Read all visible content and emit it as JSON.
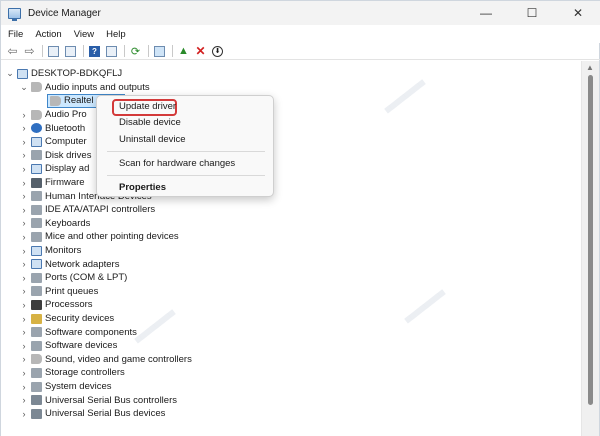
{
  "window": {
    "title": "Device Manager",
    "controls": {
      "minimize": "—",
      "maximize": "☐",
      "close": "✕"
    }
  },
  "menubar": [
    "File",
    "Action",
    "View",
    "Help"
  ],
  "toolbar": {
    "buttons": [
      "back-arrow",
      "forward-arrow",
      "properties-sheet",
      "show-hide-console",
      "help",
      "show-pane",
      "scan-hardware",
      "computer-monitor",
      "update-driver",
      "uninstall",
      "disable"
    ]
  },
  "tree": {
    "root": "DESKTOP-BDKQFLJ",
    "expanded_category": "Audio inputs and outputs",
    "selected_child": "Realtel",
    "categories": [
      "Audio Pro",
      "Bluetooth",
      "Computer",
      "Disk drives",
      "Display ad",
      "Firmware",
      "Human Interface Devices",
      "IDE ATA/ATAPI controllers",
      "Keyboards",
      "Mice and other pointing devices",
      "Monitors",
      "Network adapters",
      "Ports (COM & LPT)",
      "Print queues",
      "Processors",
      "Security devices",
      "Software components",
      "Software devices",
      "Sound, video and game controllers",
      "Storage controllers",
      "System devices",
      "Universal Serial Bus controllers",
      "Universal Serial Bus devices"
    ]
  },
  "context_menu": {
    "update_driver": "Update driver",
    "disable_device": "Disable device",
    "uninstall_device": "Uninstall device",
    "scan_hardware": "Scan for hardware changes",
    "properties": "Properties"
  },
  "colors": {
    "highlight_box": "#d33a3a",
    "selection": "#cce8ff"
  }
}
